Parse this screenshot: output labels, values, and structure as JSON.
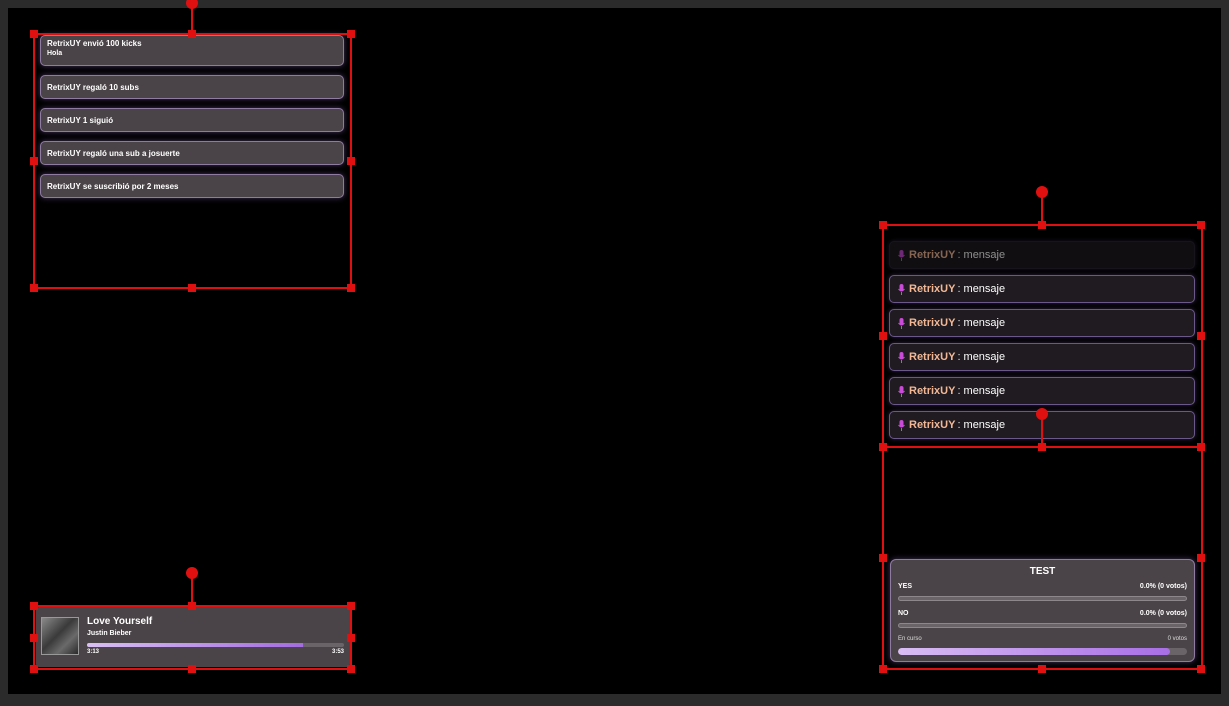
{
  "alerts": {
    "items": [
      {
        "title": "RetrixUY envió 100 kicks",
        "message": "Hola"
      },
      {
        "title": "RetrixUY regaló 10 subs"
      },
      {
        "title": "RetrixUY 1 siguió"
      },
      {
        "title": "RetrixUY regaló una sub a josuerte"
      },
      {
        "title": "RetrixUY se suscribió por 2 meses"
      }
    ]
  },
  "chat": {
    "messages": [
      {
        "user": "RetrixUY",
        "sep": ":",
        "text": "mensaje"
      },
      {
        "user": "RetrixUY",
        "sep": ":",
        "text": "mensaje"
      },
      {
        "user": "RetrixUY",
        "sep": ":",
        "text": "mensaje"
      },
      {
        "user": "RetrixUY",
        "sep": ":",
        "text": "mensaje"
      },
      {
        "user": "RetrixUY",
        "sep": ":",
        "text": "mensaje"
      },
      {
        "user": "RetrixUY",
        "sep": ":",
        "text": "mensaje"
      }
    ],
    "icon": "microphone-icon",
    "username_color": "#f2b896",
    "icon_color": "#c94bd8"
  },
  "poll": {
    "title": "TEST",
    "options": [
      {
        "label": "YES",
        "result": "0.0% (0 votos)",
        "fraction": 0
      },
      {
        "label": "NO",
        "result": "0.0% (0 votos)",
        "fraction": 0
      }
    ],
    "status": "En curso",
    "total_votes": "0 votos",
    "time_remaining_fraction": 0.94
  },
  "music": {
    "title": "Love Yourself",
    "artist": "Justin Bieber",
    "current_time": "3:13",
    "total_time": "3:53",
    "progress_fraction": 0.84,
    "accent": "#a36ce0"
  }
}
